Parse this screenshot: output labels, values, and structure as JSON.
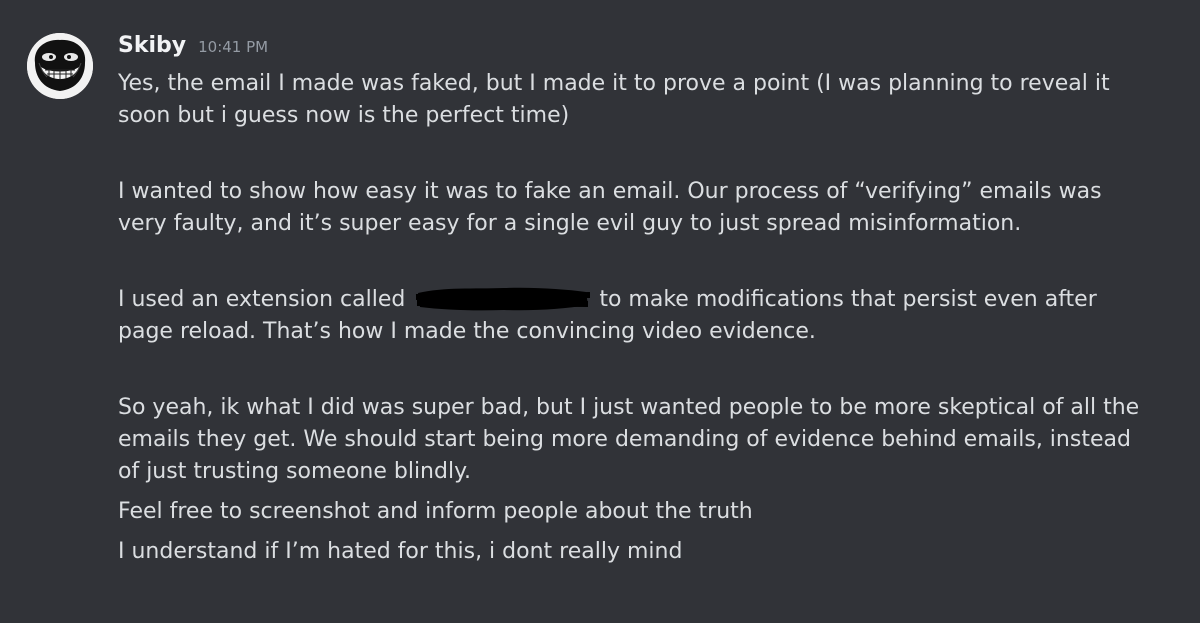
{
  "message": {
    "author": "Skiby",
    "timestamp": "10:41 PM",
    "avatar_icon": "trollface-icon",
    "lines": [
      "Yes, the email I made was faked, but I made it to prove a point (I was planning to reveal it",
      "soon but i guess now is the perfect time)",
      "I wanted to show how easy it was to fake an email. Our process of “verifying” emails was",
      "very faulty, and it’s super easy for a single evil guy to just spread misinformation.",
      "I used an extension called",
      "to make modifications that persist even after",
      "page reload. That’s how I made the convincing video evidence.",
      "So yeah, ik what I did was super bad, but I just wanted people to be more skeptical of all the",
      "emails they get. We should start being more demanding of evidence behind emails, instead",
      "of just trusting someone blindly.",
      "Feel free to screenshot and inform people about the truth",
      "I understand if I’m hated for this, i dont really mind"
    ]
  },
  "colors": {
    "background": "#313338",
    "text": "#dbdee1",
    "username": "#f2f3f5",
    "timestamp": "#949ba4",
    "redaction": "#000000"
  }
}
